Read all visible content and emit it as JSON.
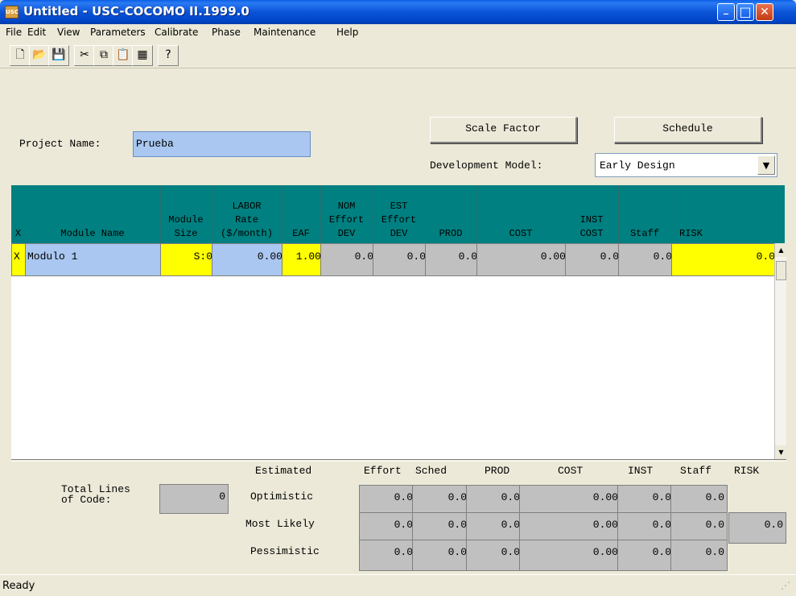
{
  "window": {
    "title": "Untitled - USC-COCOMO II.1999.0",
    "app_icon_text": "USC",
    "controls": {
      "minimize": "_",
      "maximize": "□",
      "close": "✕"
    }
  },
  "menu": [
    "File",
    "Edit",
    "View",
    "Parameters",
    "Calibrate",
    "Phase",
    "Maintenance",
    "Help"
  ],
  "toolbar": [
    {
      "name": "new-file-icon",
      "glyph": "🗋",
      "disabled": false
    },
    {
      "name": "open-folder-icon",
      "glyph": "📂",
      "disabled": false
    },
    {
      "name": "save-icon",
      "glyph": "💾",
      "disabled": false
    },
    {
      "name": "cut-icon",
      "glyph": "✂",
      "disabled": false
    },
    {
      "name": "copy-icon",
      "glyph": "⧉",
      "disabled": false
    },
    {
      "name": "paste-icon",
      "glyph": "📋",
      "disabled": true
    },
    {
      "name": "insert-module-icon",
      "glyph": "▦",
      "disabled": false
    },
    {
      "name": "help-icon",
      "glyph": "?",
      "disabled": false
    }
  ],
  "project": {
    "label": "Project Name:",
    "value": "Prueba"
  },
  "buttons": {
    "scale_factor": "Scale Factor",
    "schedule": "Schedule"
  },
  "development_model": {
    "label": "Development Model:",
    "value": "Early Design"
  },
  "table": {
    "headers": [
      "X",
      "Module Name",
      "Module\nSize",
      "LABOR\nRate\n($/month)",
      "EAF",
      "NOM\nEffort\nDEV",
      "EST\nEffort\nDEV",
      "PROD",
      "COST",
      "INST\nCOST",
      "Staff",
      "RISK"
    ],
    "rows": [
      {
        "x": "X",
        "module_name": "Modulo 1",
        "module_size": "S:0",
        "labor_rate": "0.00",
        "eaf": "1.00",
        "nom_effort": "0.0",
        "est_effort": "0.0",
        "prod": "0.0",
        "cost": "0.00",
        "inst_cost": "0.0",
        "staff": "0.0",
        "risk": "0.0"
      }
    ]
  },
  "totals": {
    "lines_label_1": "Total Lines",
    "lines_label_2": "of Code:",
    "lines_value": "0",
    "headers": [
      "Estimated",
      "Effort",
      "Sched",
      "PROD",
      "COST",
      "INST",
      "Staff",
      "RISK"
    ],
    "rows": [
      {
        "label": "Optimistic",
        "effort": "0.0",
        "sched": "0.0",
        "prod": "0.0",
        "cost": "0.00",
        "inst": "0.0",
        "staff": "0.0"
      },
      {
        "label": "Most Likely",
        "effort": "0.0",
        "sched": "0.0",
        "prod": "0.0",
        "cost": "0.00",
        "inst": "0.0",
        "staff": "0.0",
        "risk": "0.0"
      },
      {
        "label": "Pessimistic",
        "effort": "0.0",
        "sched": "0.0",
        "prod": "0.0",
        "cost": "0.00",
        "inst": "0.0",
        "staff": "0.0"
      }
    ]
  },
  "status": "Ready"
}
